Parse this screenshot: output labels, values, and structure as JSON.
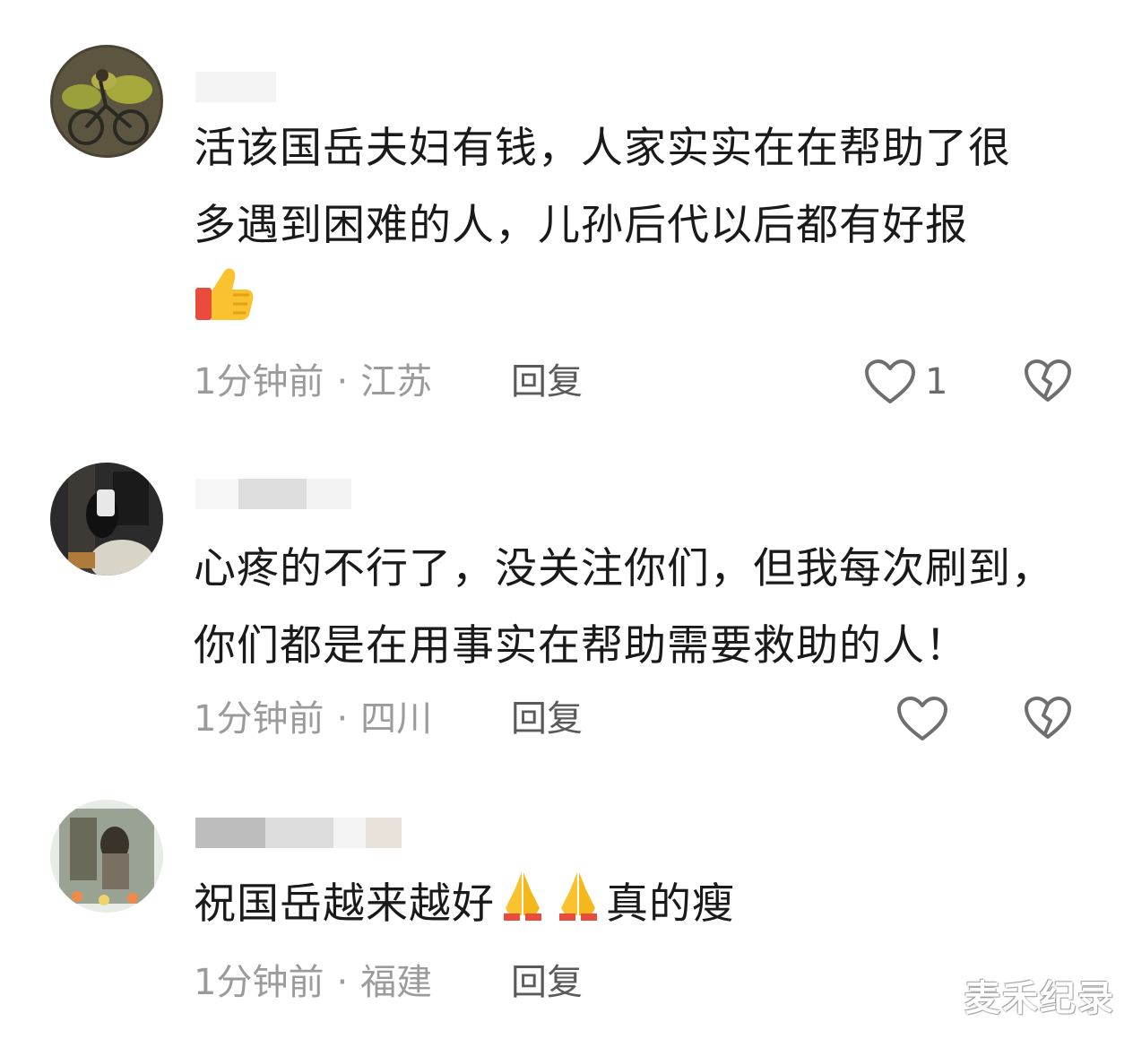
{
  "comments": [
    {
      "text_line1": "活该国岳夫妇有钱，人家实实在在帮助了很",
      "text_line2": "多遇到困难的人，儿孙后代以后都有好报",
      "emoji": "thumbs-up",
      "time": "1分钟前",
      "separator": "·",
      "location": "江苏",
      "reply_label": "回复",
      "like_count": "1"
    },
    {
      "text_line1": "心疼的不行了，没关注你们，但我每次刷到，",
      "text_line2": "你们都是在用事实在帮助需要救助的人！",
      "time": "1分钟前",
      "separator": "·",
      "location": "四川",
      "reply_label": "回复"
    },
    {
      "text_before_emoji": "祝国岳越来越好",
      "emoji": "folded-hands",
      "text_after_emoji": "真的瘦",
      "time": "1分钟前",
      "separator": "·",
      "location": "福建",
      "reply_label": "回复"
    }
  ],
  "watermark": "麦禾纪录",
  "colors": {
    "meta_text": "#9b9b9b",
    "reply_text": "#5a5a5a",
    "icon_stroke": "#6f6f6f",
    "body_text": "#1a1a1a"
  }
}
